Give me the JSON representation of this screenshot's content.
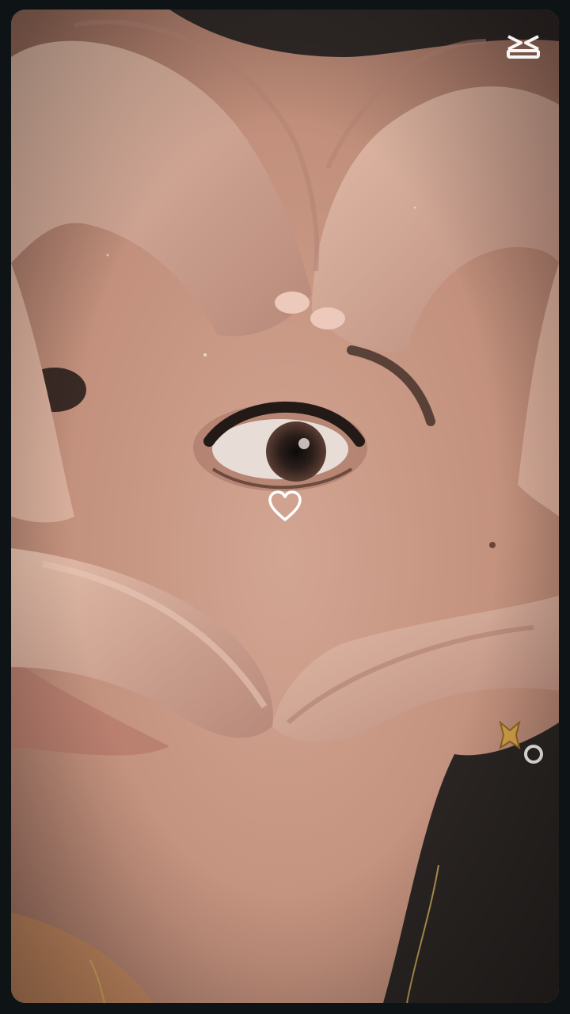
{
  "app": {
    "name": "CapCut",
    "logo_icon": "capcut-logo-icon"
  },
  "overlay": {
    "icon": "heart-outline-icon",
    "color": "#ffffff"
  },
  "photo": {
    "description_icon": "photo-content",
    "palette": {
      "skin": "#c79a86",
      "skin_dark": "#9c6e5e",
      "skin_light": "#e0b9a6",
      "hair": "#2a2523",
      "background": "#0e1316"
    }
  }
}
